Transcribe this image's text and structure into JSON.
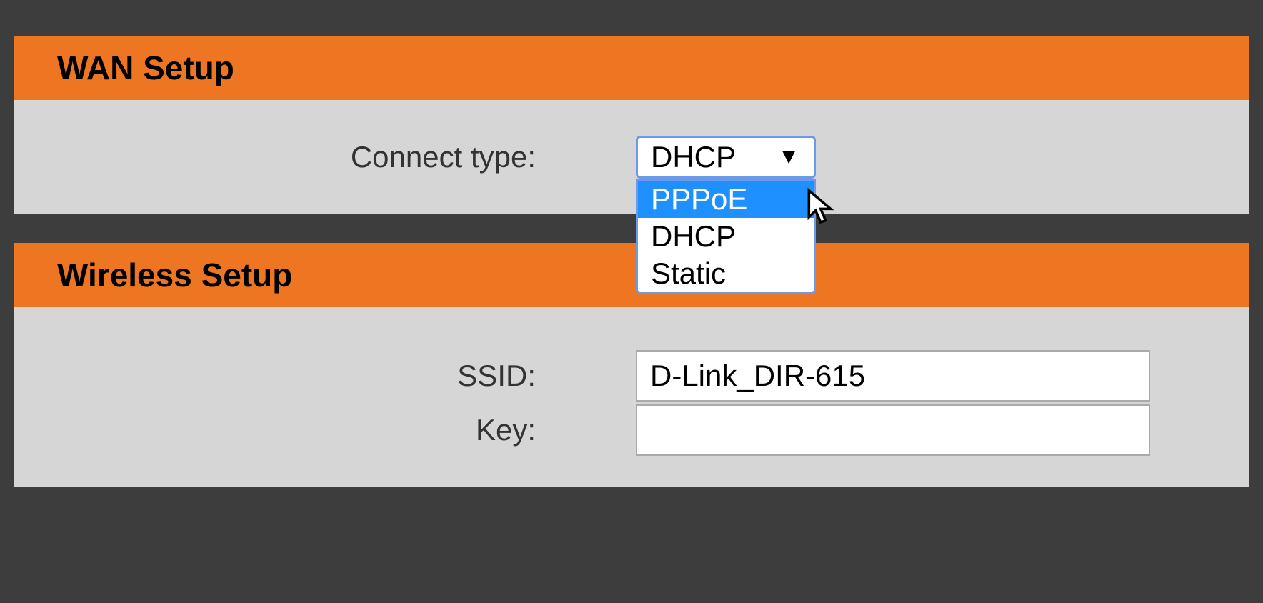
{
  "wan": {
    "title": "WAN Setup",
    "connect_type_label": "Connect type:",
    "connect_type_selected": "DHCP",
    "options": {
      "0": "PPPoE",
      "1": "DHCP",
      "2": "Static"
    }
  },
  "wireless": {
    "title": "Wireless Setup",
    "ssid_label": "SSID:",
    "ssid_value": "D-Link_DIR-615",
    "key_label": "Key:",
    "key_value": ""
  }
}
